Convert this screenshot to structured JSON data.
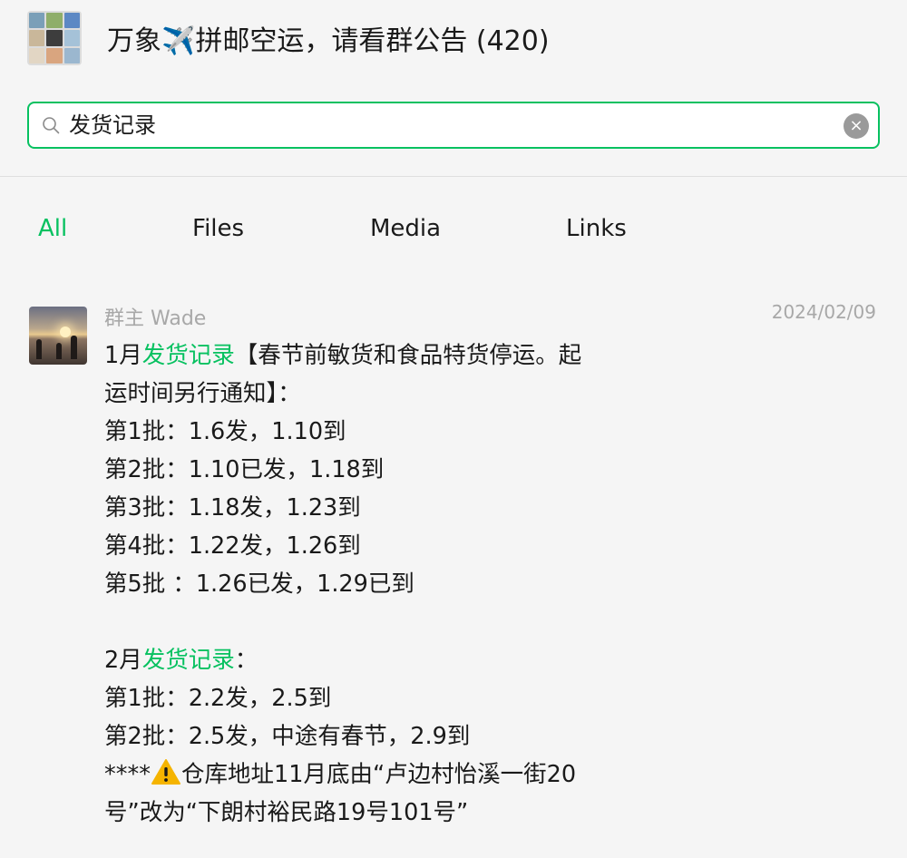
{
  "header": {
    "title": "万象✈️拼邮空运，请看群公告 (420)"
  },
  "search": {
    "value": "发货记录",
    "icon": "search-icon",
    "clear_icon": "×"
  },
  "tabs": [
    {
      "label": "All",
      "active": true
    },
    {
      "label": "Files",
      "active": false
    },
    {
      "label": "Media",
      "active": false
    },
    {
      "label": "Links",
      "active": false
    }
  ],
  "message": {
    "sender": "群主 Wade",
    "date": "2024/02/09",
    "lines": [
      {
        "a": "1月",
        "hl": "发货记录",
        "b": "【春节前敏货和食品特货停运。起"
      },
      {
        "a": "运时间另行通知】：",
        "hl": "",
        "b": ""
      },
      {
        "a": "第1批：1.6发，1.10到",
        "hl": "",
        "b": ""
      },
      {
        "a": "第2批：1.10已发，1.18到",
        "hl": "",
        "b": ""
      },
      {
        "a": "第3批：1.18发，1.23到",
        "hl": "",
        "b": ""
      },
      {
        "a": "第4批：1.22发，1.26到",
        "hl": "",
        "b": ""
      },
      {
        "a": "第5批 ：1.26已发，1.29已到",
        "hl": "",
        "b": ""
      },
      {
        "a": "",
        "hl": "",
        "b": ""
      },
      {
        "a": "2月",
        "hl": "发货记录",
        "b": "："
      },
      {
        "a": "第1批：2.2发，2.5到",
        "hl": "",
        "b": ""
      },
      {
        "a": "第2批：2.5发，中途有春节，2.9到",
        "hl": "",
        "b": ""
      },
      {
        "a": "****",
        "hl": "",
        "b": "仓库地址11月底由“卢边村怡溪一街20",
        "warn": true
      },
      {
        "a": "号”改为“下朗村裕民路19号101号”",
        "hl": "",
        "b": ""
      }
    ]
  },
  "colors": {
    "accent": "#07c160",
    "muted": "#a8a8a8",
    "background": "#f5f5f5"
  }
}
